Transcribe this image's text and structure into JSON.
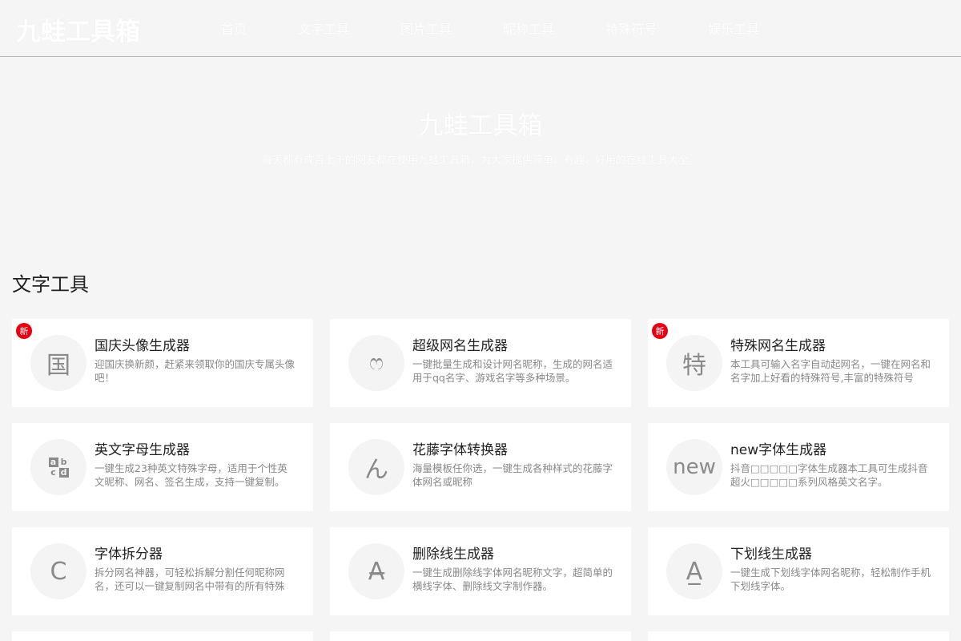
{
  "header": {
    "logo": "九蛙工具箱",
    "nav": [
      "首页",
      "文字工具",
      "图片工具",
      "昵称工具",
      "特殊符号",
      "娱乐工具"
    ]
  },
  "hero": {
    "title": "九蛙工具箱",
    "subtitle": "每天都有成百上千的网友都在使用九蛙工具箱，为大家提供简单、有趣、好用的在线工具大全。"
  },
  "section": {
    "title": "文字工具",
    "cards": [
      {
        "icon": "国",
        "title": "国庆头像生成器",
        "desc": "迎国庆换新颜，赶紧来领取你的国庆专属头像吧！",
        "badge": "新"
      },
      {
        "icon": "ෆ",
        "title": "超级网名生成器",
        "desc": "一键批量生成和设计网名昵称，生成的网名适用于qq名字、游戏名字等多种场景。",
        "badge": ""
      },
      {
        "icon": "特",
        "title": "特殊网名生成器",
        "desc": "本工具可输入名字自动起网名，一键在网名和名字加上好看的特殊符号,丰富的特殊符号",
        "badge": "新"
      },
      {
        "icon": "abcd",
        "title": "英文字母生成器",
        "desc": "一键生成23种英文特殊字母，适用于个性英文昵称、网名、签名生成，支持一键复制。",
        "badge": ""
      },
      {
        "icon": "ん",
        "title": "花藤字体转换器",
        "desc": "海量模板任你选，一键生成各种样式的花藤字体网名或昵称",
        "badge": ""
      },
      {
        "icon": "new",
        "title": "new字体生成器",
        "desc": "抖音□□□□□字体生成器本工具可生成抖音超火□□□□□系列风格英文名字。",
        "badge": ""
      },
      {
        "icon": "C",
        "title": "字体拆分器",
        "desc": "拆分网名神器，可轻松拆解分割任何昵称网名，还可以一键复制网名中带有的所有特殊",
        "badge": ""
      },
      {
        "icon": "A̶",
        "title": "删除线生成器",
        "desc": "一键生成删除线字体网名昵称文字，超简单的横线字体、删除线文字制作器。",
        "badge": ""
      },
      {
        "icon": "A̲",
        "title": "下划线生成器",
        "desc": "一键生成下划线字体网名昵称，轻松制作手机下划线字体。",
        "badge": ""
      }
    ]
  },
  "abcd_letters": [
    "a",
    "b",
    "c",
    "d"
  ]
}
